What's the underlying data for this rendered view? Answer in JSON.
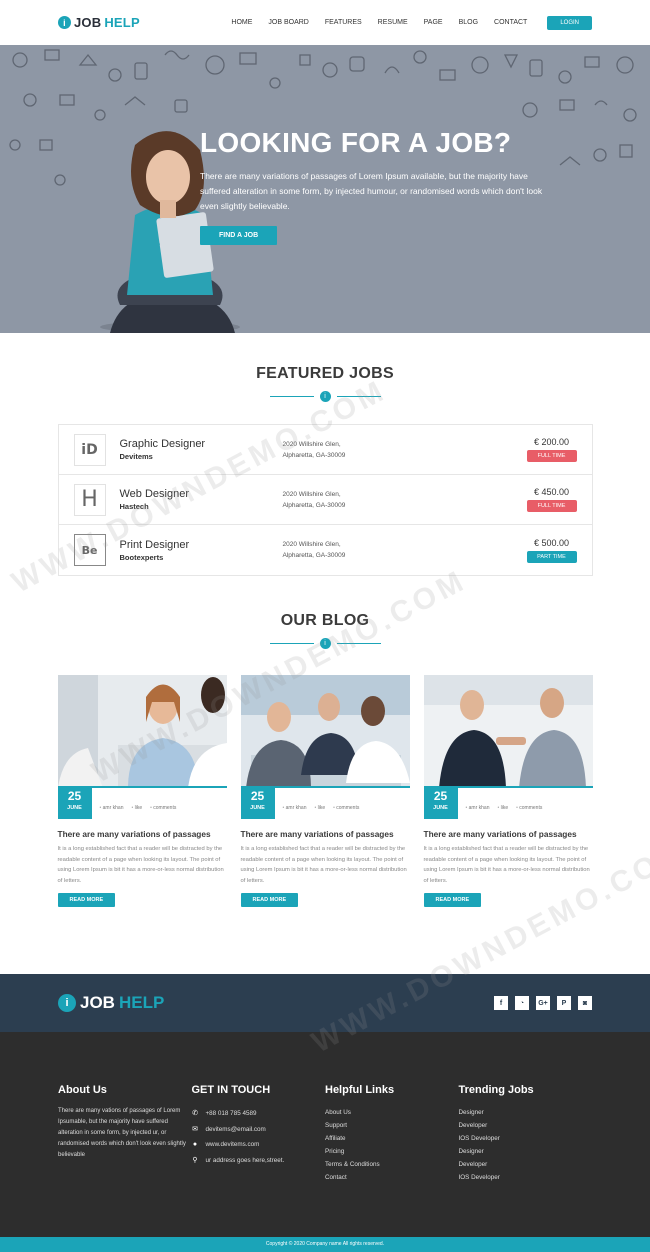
{
  "nav": {
    "logo_prefix": "JOB",
    "logo_suffix": "HELP",
    "items": [
      "HOME",
      "JOB BOARD",
      "FEATURES",
      "RESUME",
      "PAGE",
      "BLOG",
      "CONTACT"
    ],
    "login": "LOGIN"
  },
  "hero": {
    "title": "LOOKING FOR A JOB?",
    "text": "There are many variations of passages of Lorem Ipsum available, but the majority have suffered alteration in some form, by injected humour, or randomised words which don't look even slightly believable.",
    "button": "FIND A JOB"
  },
  "jobs": {
    "title": "FEATURED JOBS",
    "items": [
      {
        "logo": "iD",
        "title": "Graphic Designer",
        "company": "Devitems",
        "addr1": "2020 Willshire Glen,",
        "addr2": "Alpharetta, GA-30009",
        "price": "€ 200.00",
        "type": "FULL TIME",
        "badge_color": "#e85d67"
      },
      {
        "logo": "H",
        "title": "Web Designer",
        "company": "Hastech",
        "addr1": "2020 Willshire Glen,",
        "addr2": "Alpharetta, GA-30009",
        "price": "€ 450.00",
        "type": "FULL TIME",
        "badge_color": "#e85d67"
      },
      {
        "logo": "Be",
        "title": "Print Designer",
        "company": "Bootexperts",
        "addr1": "2020 Willshire Glen,",
        "addr2": "Alpharetta, GA-30009",
        "price": "€ 500.00",
        "type": "PART TIME",
        "badge_color": "#1ba4b8"
      }
    ]
  },
  "blog": {
    "title": "OUR BLOG",
    "posts": [
      {
        "day": "25",
        "month": "JUNE",
        "author": "amr khan",
        "likes": "like",
        "comments": "comments",
        "title": "There are many variations of passages",
        "text": "It is a long established fact that a reader will be distracted by the readable content of a page when looking its layout. The point of using Lorem Ipsum is bit it has a more-or-less normal distribution of letters.",
        "button": "READ MORE"
      },
      {
        "day": "25",
        "month": "JUNE",
        "author": "amr khan",
        "likes": "like",
        "comments": "comments",
        "title": "There are many variations of passages",
        "text": "It is a long established fact that a reader will be distracted by the readable content of a page when looking its layout. The point of using Lorem Ipsum is bit it has a more-or-less normal distribution of letters.",
        "button": "READ MORE"
      },
      {
        "day": "25",
        "month": "JUNE",
        "author": "amr khan",
        "likes": "like",
        "comments": "comments",
        "title": "There are many variations of passages",
        "text": "It is a long established fact that a reader will be distracted by the readable content of a page when looking its layout. The point of using Lorem Ipsum is bit it has a more-or-less normal distribution of letters.",
        "button": "READ MORE"
      }
    ]
  },
  "footer": {
    "logo_prefix": "JOB",
    "logo_suffix": "HELP",
    "socials": [
      "f",
      "rss",
      "G+",
      "P",
      "ig"
    ],
    "about": {
      "title": "About Us",
      "text": "There are many vations of passages of Lorem Ipsumable, but the majority have suffered alteration in some form, by injected ur, or randomised words which don't look even slightly believable"
    },
    "contact": {
      "title": "GET IN TOUCH",
      "phone": "+88 018 785 4589",
      "email": "devitems@email.com",
      "web": "www.devitems.com",
      "address": "ur address goes here,street."
    },
    "links": {
      "title": "Helpful Links",
      "items": [
        "About Us",
        "Support",
        "Affiliate",
        "Pricing",
        "Terms & Conditions",
        "Contact"
      ]
    },
    "trending": {
      "title": "Trending Jobs",
      "items": [
        "Designer",
        "Developer",
        "IOS Developer",
        "Designer",
        "Developer",
        "IOS Developer"
      ]
    },
    "copyright": "Copyright © 2020 Company name All rights reserved."
  },
  "watermark": "WWW.DOWNDEMO.COM",
  "colors": {
    "accent": "#1ba4b8",
    "footer_top": "#2c3e50",
    "footer_main": "#2d2d2d",
    "hero_bg": "#8e97a5"
  }
}
